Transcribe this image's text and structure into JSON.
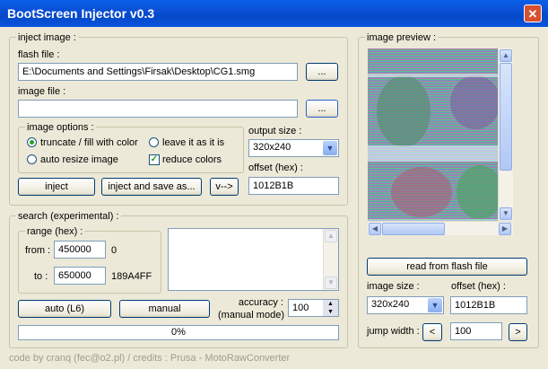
{
  "window": {
    "title": "BootScreen Injector v0.3",
    "close_glyph": "✕"
  },
  "inject": {
    "group_label": "inject image :",
    "flash_file_label": "flash file :",
    "flash_file_value": "E:\\Documents and Settings\\Firsak\\Desktop\\CG1.smg",
    "browse_label": "...",
    "image_file_label": "image file :",
    "image_file_value": "",
    "options": {
      "group_label": "image options :",
      "truncate": "truncate / fill with color",
      "leave": "leave it as it is",
      "auto_resize": "auto resize image",
      "reduce_colors": "reduce colors",
      "selected": "truncate",
      "reduce_checked": true,
      "check_glyph": "✓"
    },
    "output_size_label": "output size :",
    "output_size_value": "320x240",
    "offset_label": "offset (hex) :",
    "offset_value": "1012B1B",
    "inject_button": "inject",
    "inject_save_button": "inject and save as...",
    "arrow_button": "v-->"
  },
  "search": {
    "group_label": "search (experimental) :",
    "range_label": "range (hex) :",
    "from_label": "from :",
    "from_value": "450000",
    "from_dec": "0",
    "to_label": "to :",
    "to_value": "650000",
    "to_dec": "189A4FF",
    "auto_button": "auto (L6)",
    "manual_button": "manual",
    "accuracy_label": "accuracy :",
    "accuracy_sub": "(manual mode)",
    "accuracy_value": "100",
    "progress_text": "0%",
    "progress_value": 0
  },
  "preview": {
    "group_label": "image preview :",
    "read_button": "read from flash file",
    "image_size_label": "image size :",
    "image_size_value": "320x240",
    "offset_label": "offset (hex) :",
    "offset_value": "1012B1B",
    "jump_label": "jump width :",
    "jump_value": "100",
    "prev_glyph": "<",
    "next_glyph": ">"
  },
  "footer": "code by cranq (fec@o2.pl) / credits : Prusa - MotoRawConverter",
  "colors": {
    "title_bar": "#0a4fd6",
    "window_bg": "#ece9d8",
    "close": "#d7502f",
    "selected_radio": "#21a121"
  }
}
